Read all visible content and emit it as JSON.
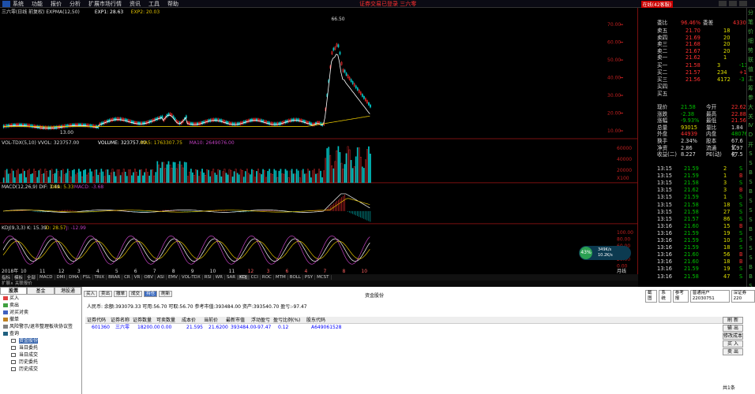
{
  "menu": {
    "items": [
      "系统",
      "功能",
      "报价",
      "分析",
      "扩展市场行情",
      "资讯",
      "工具",
      "帮助"
    ],
    "notice": "证券交易已登录   三六零",
    "badge": "在线(42客服)"
  },
  "chart": {
    "title": "三六零(日线 前复权) EXPMA(12,50)",
    "exp1": "EXP1: 28.63",
    "exp2": "EXP2: 20.03",
    "peak": "66.50",
    "low": "13.00",
    "price_axis": [
      "70.00",
      "60.00",
      "50.00",
      "40.00",
      "30.00",
      "20.00",
      "10.00"
    ],
    "vol": {
      "title": "VOL-TDX(5,10) VVOL: 323757.00",
      "volume": "VOLUME: 323757.00",
      "ma5": "MA5: 1763307.75",
      "ma10": "MA10: 2649076.00",
      "axis": [
        "60000",
        "40000",
        "20000"
      ],
      "unit": "X100"
    },
    "macd": {
      "title": "MACD(12,26,9) DIF: 3.49",
      "dea": "DEA: 5.33",
      "macd": "MACD: -3.68"
    },
    "kdj": {
      "title": "KDJ(9,3,3) K: 15.39",
      "d": "D: 28.57",
      "j": "J: -12.99",
      "axis": [
        "100.00",
        "80.00",
        "60.00",
        "40.00",
        "20.00",
        "0.00"
      ]
    },
    "xaxis": [
      "2018年",
      "10",
      "11",
      "12",
      "3",
      "4",
      "5",
      "6",
      "7",
      "8",
      "9",
      "10",
      "11",
      "12",
      "3",
      "6",
      "4",
      "7",
      "8",
      "10"
    ],
    "period": "月线"
  },
  "gauge": {
    "pct": "43%",
    "up": "349K/s",
    "down": "10.2K/s"
  },
  "quote": {
    "ratio": {
      "label": "委比",
      "value": "96.46%",
      "label2": "委差",
      "value2": "4330"
    },
    "asks": [
      {
        "l": "卖五",
        "p": "21.70",
        "v": "18"
      },
      {
        "l": "卖四",
        "p": "21.69",
        "v": "20"
      },
      {
        "l": "卖三",
        "p": "21.68",
        "v": "20"
      },
      {
        "l": "卖二",
        "p": "21.67",
        "v": "20"
      },
      {
        "l": "卖一",
        "p": "21.62",
        "v": "1"
      }
    ],
    "bids": [
      {
        "l": "买一",
        "p": "21.58",
        "v": "3",
        "c": "-13"
      },
      {
        "l": "买二",
        "p": "21.57",
        "v": "234",
        "c": "+16"
      },
      {
        "l": "买三",
        "p": "21.56",
        "v": "4172",
        "c": "-3"
      },
      {
        "l": "买四",
        "p": "",
        "v": "",
        "c": ""
      },
      {
        "l": "买五",
        "p": "",
        "v": "",
        "c": ""
      }
    ],
    "stats": [
      [
        "现价",
        "21.58",
        "今开",
        "22.62"
      ],
      [
        "涨跌",
        "-2.38",
        "最高",
        "22.88"
      ],
      [
        "涨幅",
        "-9.93%",
        "最低",
        "21.56"
      ],
      [
        "总量",
        "93015",
        "量比",
        "1.84"
      ],
      [
        "外盘",
        "44939",
        "内盘",
        "48076"
      ],
      [
        "换手",
        "2.34%",
        "股本",
        "67.6亿"
      ],
      [
        "净资",
        "2.86",
        "流通",
        "3.97亿"
      ],
      [
        "收益(二)",
        "8.227",
        "PE(动)",
        "47.5"
      ]
    ],
    "ticks": [
      [
        "13:15",
        "21.59",
        "2",
        "S"
      ],
      [
        "13:15",
        "21.59",
        "1",
        "B"
      ],
      [
        "13:15",
        "21.58",
        "3",
        "S"
      ],
      [
        "13:15",
        "21.62",
        "3",
        "B"
      ],
      [
        "13:15",
        "21.59",
        "1",
        "S"
      ],
      [
        "13:15",
        "21.58",
        "18",
        "S"
      ],
      [
        "13:15",
        "21.58",
        "27",
        "S"
      ],
      [
        "13:15",
        "21.57",
        "86",
        "S"
      ],
      [
        "13:16",
        "21.60",
        "15",
        "B"
      ],
      [
        "13:16",
        "21.59",
        "19",
        "S"
      ],
      [
        "13:16",
        "21.59",
        "10",
        "S"
      ],
      [
        "13:16",
        "21.59",
        "18",
        "S"
      ],
      [
        "13:16",
        "21.60",
        "56",
        "B"
      ],
      [
        "13:16",
        "21.60",
        "18",
        "B"
      ],
      [
        "13:16",
        "21.59",
        "19",
        "S"
      ],
      [
        "13:16",
        "21.58",
        "47",
        "S"
      ]
    ],
    "sidebar": [
      "分",
      "笔",
      "价",
      "细",
      "势",
      "联",
      "值",
      "主",
      "筹",
      "参",
      "大",
      "关",
      "Ⅳ",
      "D",
      "开",
      "S",
      "S",
      "B",
      "S",
      "B",
      "S",
      "S",
      "S",
      "B",
      "S",
      "S",
      "S",
      "B",
      "B",
      "S",
      "S"
    ]
  },
  "tabs": [
    "指标",
    "模板",
    "全部",
    "MACD",
    "DMI",
    "DMA",
    "FSL",
    "TRIX",
    "BRAR",
    "CR",
    "VR",
    "OBV",
    "ASI",
    "EMV",
    "VOL-TDX",
    "RSI",
    "WR",
    "SAR",
    "KDJ",
    "CCI",
    "ROC",
    "MTM",
    "BOLL",
    "PSY",
    "MCST"
  ],
  "status_bar": "扩展∧  关联报价",
  "trade": {
    "ltabs": [
      "股票",
      "基金",
      "港股通"
    ],
    "tree": [
      {
        "t": "买入",
        "s": false
      },
      {
        "t": "卖出",
        "s": false
      },
      {
        "t": "对买对卖",
        "s": false
      },
      {
        "t": "撤单",
        "s": false
      },
      {
        "t": "风险警示/退市整理板块协议签",
        "s": false
      },
      {
        "t": "查询",
        "s": false
      }
    ],
    "tree_sub": [
      {
        "t": "资金股份",
        "s": true
      },
      {
        "t": "当日委托",
        "s": false
      },
      {
        "t": "当日成交",
        "s": false
      },
      {
        "t": "历史委托",
        "s": false
      },
      {
        "t": "历史成交",
        "s": false
      }
    ],
    "toolbar": [
      "买入",
      "卖出",
      "撤单",
      "成交",
      "持仓",
      "刷新"
    ],
    "title": "资金股份",
    "acct_buttons": [
      "截图",
      "系统",
      "参考报",
      "普通用户 22030751",
      "深证券 220"
    ],
    "info": "人民币: 余额:393079.33  可用:56.70  可取:56.70  参考市值:393484.00  资产:393540.70  盈亏:-97.47",
    "columns": [
      "证券代码",
      "证券名称",
      "证券数量",
      "可卖数量",
      "成本价",
      "当前价",
      "最新市值",
      "浮动盈亏",
      "盈亏比例(%)",
      "股东代码"
    ],
    "row": [
      "601360",
      "三六零",
      "18200.00",
      "0.00",
      "21.595",
      "21.6200",
      "393484.00",
      "-97.47",
      "0.12",
      "A649061528"
    ],
    "rbtns": [
      "刷 新",
      "输 出",
      "修改成本",
      "买 入",
      "卖 出"
    ],
    "footer": "共1条"
  }
}
